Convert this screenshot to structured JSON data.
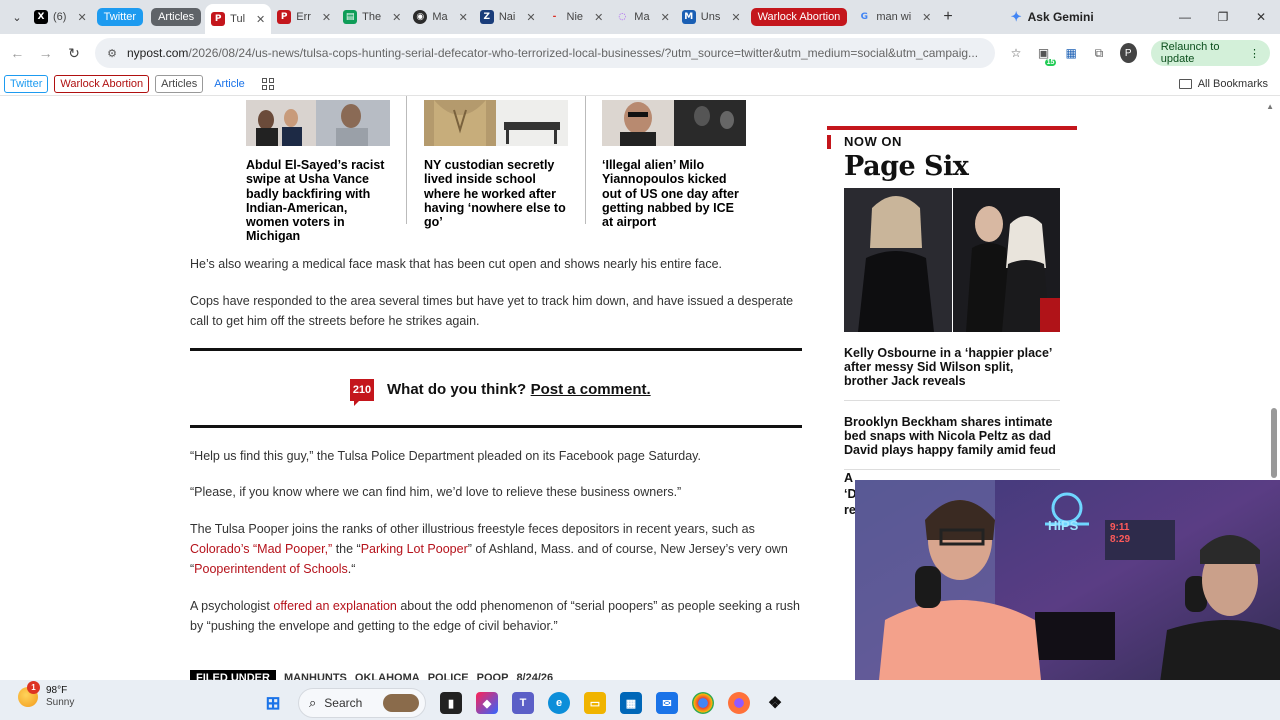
{
  "tabs": [
    {
      "label": "(6)",
      "fav": "x-icon",
      "color": "#000000"
    },
    {
      "label": "Tul",
      "fav": "nypost-icon",
      "color": "#c4161c",
      "active": true
    },
    {
      "label": "Err",
      "fav": "nypost-icon",
      "color": "#c4161c"
    },
    {
      "label": "The",
      "fav": "doc-icon",
      "color": "#0f9d58"
    },
    {
      "label": "Ma",
      "fav": "globe-icon",
      "color": "#2b2b2b"
    },
    {
      "label": "Nai",
      "fav": "z-icon",
      "color": "#1a3d7a"
    },
    {
      "label": "Nie",
      "fav": "dash-icon",
      "color": "#d93025"
    },
    {
      "label": "Ma",
      "fav": "loader-icon",
      "color": "#a142f4"
    },
    {
      "label": "Uns",
      "fav": "m-icon",
      "color": "#1a5fb4"
    },
    {
      "label": "man wi",
      "fav": "google-icon",
      "color": "#4285f4"
    }
  ],
  "tab_pills": {
    "twitter": "Twitter",
    "articles": "Articles",
    "warlock": "Warlock Abortion"
  },
  "gemini": "Ask Gemini",
  "address": {
    "host": "nypost.com",
    "path": "/2026/08/24/us-news/tulsa-cops-hunting-serial-defecator-who-terrorized-local-businesses/?utm_source=twitter&utm_medium=social&utm_campaig..."
  },
  "relaunch": "Relaunch to update",
  "ext_badge": "15",
  "profile": "P",
  "bookmarks": {
    "twitter": "Twitter",
    "warlock": "Warlock Abortion",
    "articles": "Articles",
    "article": "Article",
    "all": "All Bookmarks"
  },
  "related": [
    {
      "title": "Abdul El-Sayed’s racist swipe at Usha Vance badly backfiring with Indian-American, women voters in Michigan"
    },
    {
      "title": "NY custodian secretly lived inside school where he worked after having ‘nowhere else to go’"
    },
    {
      "title": "‘Illegal alien’ Milo Yiannopoulos kicked out of US one day after getting nabbed by ICE at airport"
    }
  ],
  "article": {
    "p1": "He’s also wearing a medical face mask that has been cut open and shows nearly his entire face.",
    "p2": "Cops have responded to the area several times but have yet to track him down, and have issued a desperate call to get him off the streets before he strikes again.",
    "comment_count": "210",
    "comment_q": "What do you think?",
    "comment_link": "Post a comment.",
    "p3": "“Help us find this guy,” the Tulsa Police Department pleaded on its Facebook page Saturday.",
    "p4": "“Please, if you know where we can find him, we’d love to relieve these business owners.”",
    "p5a": "The Tulsa Pooper joins the ranks of other illustrious freestyle feces depositors in recent years, such as ",
    "p5_link1": "Colorado’s “Mad Pooper,”",
    "p5b": " the “",
    "p5_link2": "Parking Lot Pooper",
    "p5c": "” of Ashland, Mass. and of course, New Jersey’s very own “",
    "p5_link3": "Pooperintendent of Schools",
    "p5d": ".“",
    "p6a": "A psychologist ",
    "p6_link": "offered an explanation",
    "p6b": " about the odd phenomenon of “serial poopers” as people seeking a rush by “pushing the envelope and getting to the edge of civil behavior.”",
    "filed_label": "FILED UNDER",
    "tags": [
      "MANHUNTS",
      "OKLAHOMA",
      "POLICE",
      "POOP",
      "8/24/26"
    ]
  },
  "sidebar": {
    "now_on": "NOW ON",
    "brand": "Page Six",
    "items": [
      "Kelly Osbourne in a ‘happier place’ after messy Sid Wilson split, brother Jack reveals",
      "Brooklyn Beckham shares intimate bed snaps with Nicola Peltz as dad David plays happy family amid feud"
    ],
    "partial": "A\n‘D\nre"
  },
  "cam": {
    "sign": "HIPS",
    "clock": "9:11\n8:29"
  },
  "taskbar": {
    "temp": "98°F",
    "cond": "Sunny",
    "search": "Search",
    "weather_badge": "1"
  }
}
